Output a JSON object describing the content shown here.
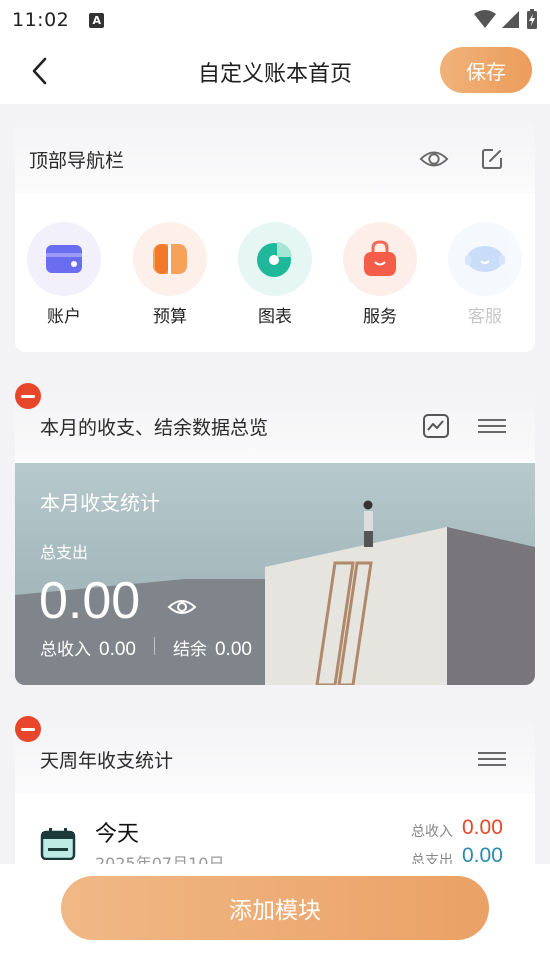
{
  "status_bar": {
    "time": "11:02",
    "notification_glyph": "A"
  },
  "header": {
    "title": "自定义账本首页",
    "save_label": "保存"
  },
  "top_nav_card": {
    "title": "顶部导航栏",
    "items": [
      {
        "label": "账户",
        "icon": "wallet-card-icon"
      },
      {
        "label": "预算",
        "icon": "budget-icon"
      },
      {
        "label": "图表",
        "icon": "pie-chart-icon"
      },
      {
        "label": "服务",
        "icon": "shopping-bag-icon"
      },
      {
        "label": "客服",
        "icon": "customer-service-icon"
      }
    ]
  },
  "overview_card": {
    "title": "本月的收支、结余数据总览",
    "banner_title": "本月收支统计",
    "expense_label": "总支出",
    "expense_value": "0.00",
    "income_label": "总收入",
    "income_value": "0.00",
    "balance_label": "结余",
    "balance_value": "0.00"
  },
  "period_card": {
    "title": "天周年收支统计",
    "row": {
      "label": "今天",
      "date": "2025年07月10日",
      "income_label": "总收入",
      "income_value": "0.00",
      "expense_label": "总支出",
      "expense_value": "0.00"
    }
  },
  "bottom": {
    "add_label": "添加模块"
  },
  "colors": {
    "accent": "#eb9d5c",
    "remove": "#e8462a",
    "income": "#e8462a",
    "expense": "#2a8ab0"
  }
}
